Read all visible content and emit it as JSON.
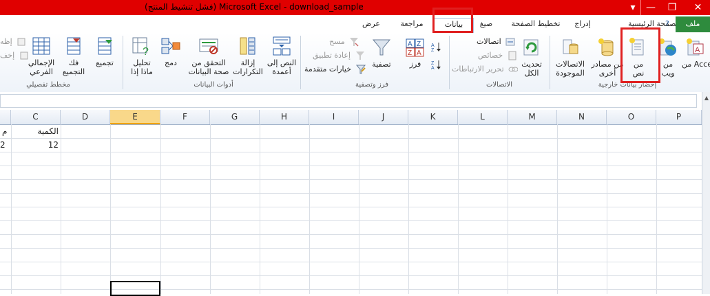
{
  "window": {
    "title": "(فشل تنشيط المنتج) Microsoft Excel - download_sample"
  },
  "tabs": {
    "file": "ملف",
    "home": "الصفحة الرئيسية",
    "insert": "إدراج",
    "page_layout": "تخطيط الصفحة",
    "formulas": "صيغ",
    "data": "بيانات",
    "review": "مراجعة",
    "view": "عرض"
  },
  "ribbon": {
    "get_external_data": {
      "label": "إحضار بيانات خارجية",
      "access": "من Access",
      "web_line1": "من",
      "web_line2": "ويب",
      "text_line1": "من",
      "text_line2": "نص",
      "other_line1": "من مصادر",
      "other_line2": "أخرى",
      "existing_line1": "الاتصالات",
      "existing_line2": "الموجودة"
    },
    "connections": {
      "label": "الاتصالات",
      "refresh_line1": "تحديث",
      "refresh_line2": "الكل",
      "connections": "اتصالات",
      "properties": "خصائص",
      "edit_links": "تحرير الارتباطات"
    },
    "sort_filter": {
      "label": "فرز وتصفية",
      "sort": "فرز",
      "filter": "تصفية",
      "clear": "مسح",
      "reapply": "إعادة تطبيق",
      "advanced": "خيارات متقدمة"
    },
    "data_tools": {
      "label": "أدوات البيانات",
      "text_to_columns_line1": "النص إلى",
      "text_to_columns_line2": "أعمدة",
      "remove_duplicates_line1": "إزالة",
      "remove_duplicates_line2": "التكرارات",
      "data_validation_line1": "التحقق من",
      "data_validation_line2": "صحة البيانات",
      "consolidate": "دمج",
      "what_if_line1": "تحليل",
      "what_if_line2": "ماذا إذا"
    },
    "outline": {
      "label": "مخطط تفصيلي",
      "group": "تجميع",
      "ungroup_line1": "فك",
      "ungroup_line2": "التجميع",
      "subtotal_line1": "الإجمالي",
      "subtotal_line2": "الفرعي",
      "show_detail": "إظه",
      "hide_detail": "إخف"
    }
  },
  "sheet": {
    "columns": [
      "P",
      "O",
      "N",
      "M",
      "L",
      "K",
      "J",
      "I",
      "H",
      "G",
      "F",
      "E",
      "D",
      "C"
    ],
    "selected_column": "E",
    "cells": {
      "C1": "الكمية",
      "C2": "12",
      "B1_partial": "م",
      "B2_partial": "2"
    }
  }
}
